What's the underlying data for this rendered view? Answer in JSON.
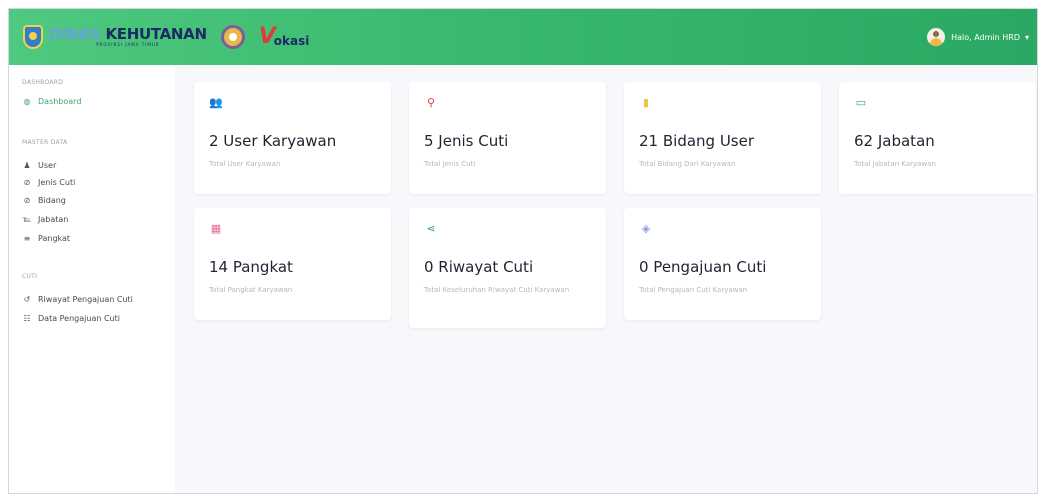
{
  "header": {
    "brand": {
      "word_pale": "DINAS",
      "word_main": "KEHUTANAN",
      "sub": "PROVINSI JAWA TIMUR"
    },
    "vokasi": {
      "v": "V",
      "rest": "okasi"
    },
    "user_label": "Halo, Admin HRD",
    "user_menu_icon": "chevron-down-icon",
    "colors": {
      "gradient_start": "#4fc97f",
      "gradient_end": "#2aa864"
    }
  },
  "sidebar": {
    "sections": [
      {
        "heading": "DASHBOARD",
        "items": [
          {
            "label": "Dashboard",
            "icon": "dashboard-icon",
            "glyph": "◍",
            "active": true
          }
        ]
      },
      {
        "heading": "MASTER DATA",
        "items": [
          {
            "label": "User",
            "icon": "user-icon",
            "glyph": "♟"
          },
          {
            "label": "Jenis Cuti",
            "icon": "paperclip-icon",
            "glyph": "⊘"
          },
          {
            "label": "Bidang",
            "icon": "paperclip-icon",
            "glyph": "⊘"
          },
          {
            "label": "Jabatan",
            "icon": "id-card-icon",
            "glyph": "℡"
          },
          {
            "label": "Pangkat",
            "icon": "menu-icon",
            "glyph": "≡"
          }
        ]
      },
      {
        "heading": "CUTI",
        "items": [
          {
            "label": "Riwayat Pengajuan Cuti",
            "icon": "history-icon",
            "glyph": "↺"
          },
          {
            "label": "Data Pengajuan Cuti",
            "icon": "list-icon",
            "glyph": "☷"
          }
        ]
      }
    ],
    "accent": "#3da86a"
  },
  "cards": [
    {
      "value": "2 User Karyawan",
      "desc": "Total User Karyawan",
      "icon": "users-icon",
      "glyph": "👥",
      "color": "#5b6fd8"
    },
    {
      "value": "5 Jenis Cuti",
      "desc": "Total Jenis Cuti",
      "icon": "sitemap-icon",
      "glyph": "⚲",
      "color": "#d8453b"
    },
    {
      "value": "21 Bidang User",
      "desc": "Total Bidang Dari Karyawan",
      "icon": "clipboard-icon",
      "glyph": "▮",
      "color": "#f2c14e"
    },
    {
      "value": "62 Jabatan",
      "desc": "Total Jabatan Karyawan",
      "icon": "id-badge-icon",
      "glyph": "▭",
      "color": "#3da86a"
    },
    {
      "value": "14 Pangkat",
      "desc": "Total Pangkat Karyawan",
      "icon": "calendar-icon",
      "glyph": "▦",
      "color": "#e86a9a"
    },
    {
      "value": "0 Riwayat Cuti",
      "desc": "Total Keseluruhan Riwayat Cuti Karyawan",
      "icon": "share-icon",
      "glyph": "⋖",
      "color": "#3da86a"
    },
    {
      "value": "0 Pengajuan Cuti",
      "desc": "Total Pengajuan Cuti Karyawan",
      "icon": "tags-icon",
      "glyph": "◈",
      "color": "#8a9be0"
    }
  ]
}
